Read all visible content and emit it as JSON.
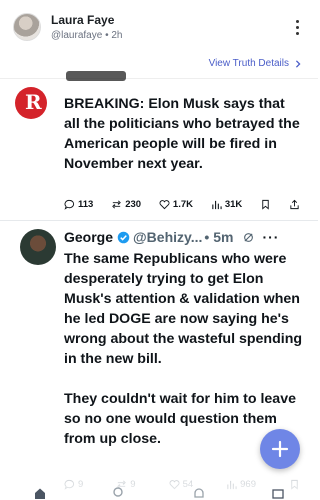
{
  "header": {
    "author_name": "Laura Faye",
    "author_meta": "@laurafaye • 2h",
    "view_details": "View Truth Details"
  },
  "embed": {
    "post1": {
      "text": "BREAKING: Elon Musk says that all the politicians who betrayed the American people will be fired in November next year.",
      "actions": {
        "replies": "113",
        "reposts": "230",
        "likes": "1.7K",
        "views": "31K"
      }
    },
    "post2": {
      "name": "George",
      "handle": "@Behizy...",
      "time": "• 5m",
      "paragraph1": "The same Republicans who were desperately trying to get Elon Musk's attention & validation when he led DOGE are now saying he's wrong about the wasteful spending in the new bill.",
      "paragraph2": "They couldn't wait for him to leave so no one would question them from up close.",
      "actions": {
        "replies": "9",
        "reposts": "9",
        "likes": "54",
        "views": "969"
      }
    }
  },
  "colors": {
    "accent": "#4a5dc8",
    "fab": "#6f86e6",
    "verified": "#1d9bf0",
    "news_logo": "#d4232a"
  },
  "icons": [
    "more-vert-icon",
    "chevron-right-icon",
    "reply-icon",
    "repost-icon",
    "like-icon",
    "views-icon",
    "bookmark-icon",
    "share-icon",
    "verified-icon",
    "grok-icon",
    "plus-icon",
    "home-icon",
    "search-icon",
    "notifications-icon",
    "messages-icon"
  ]
}
